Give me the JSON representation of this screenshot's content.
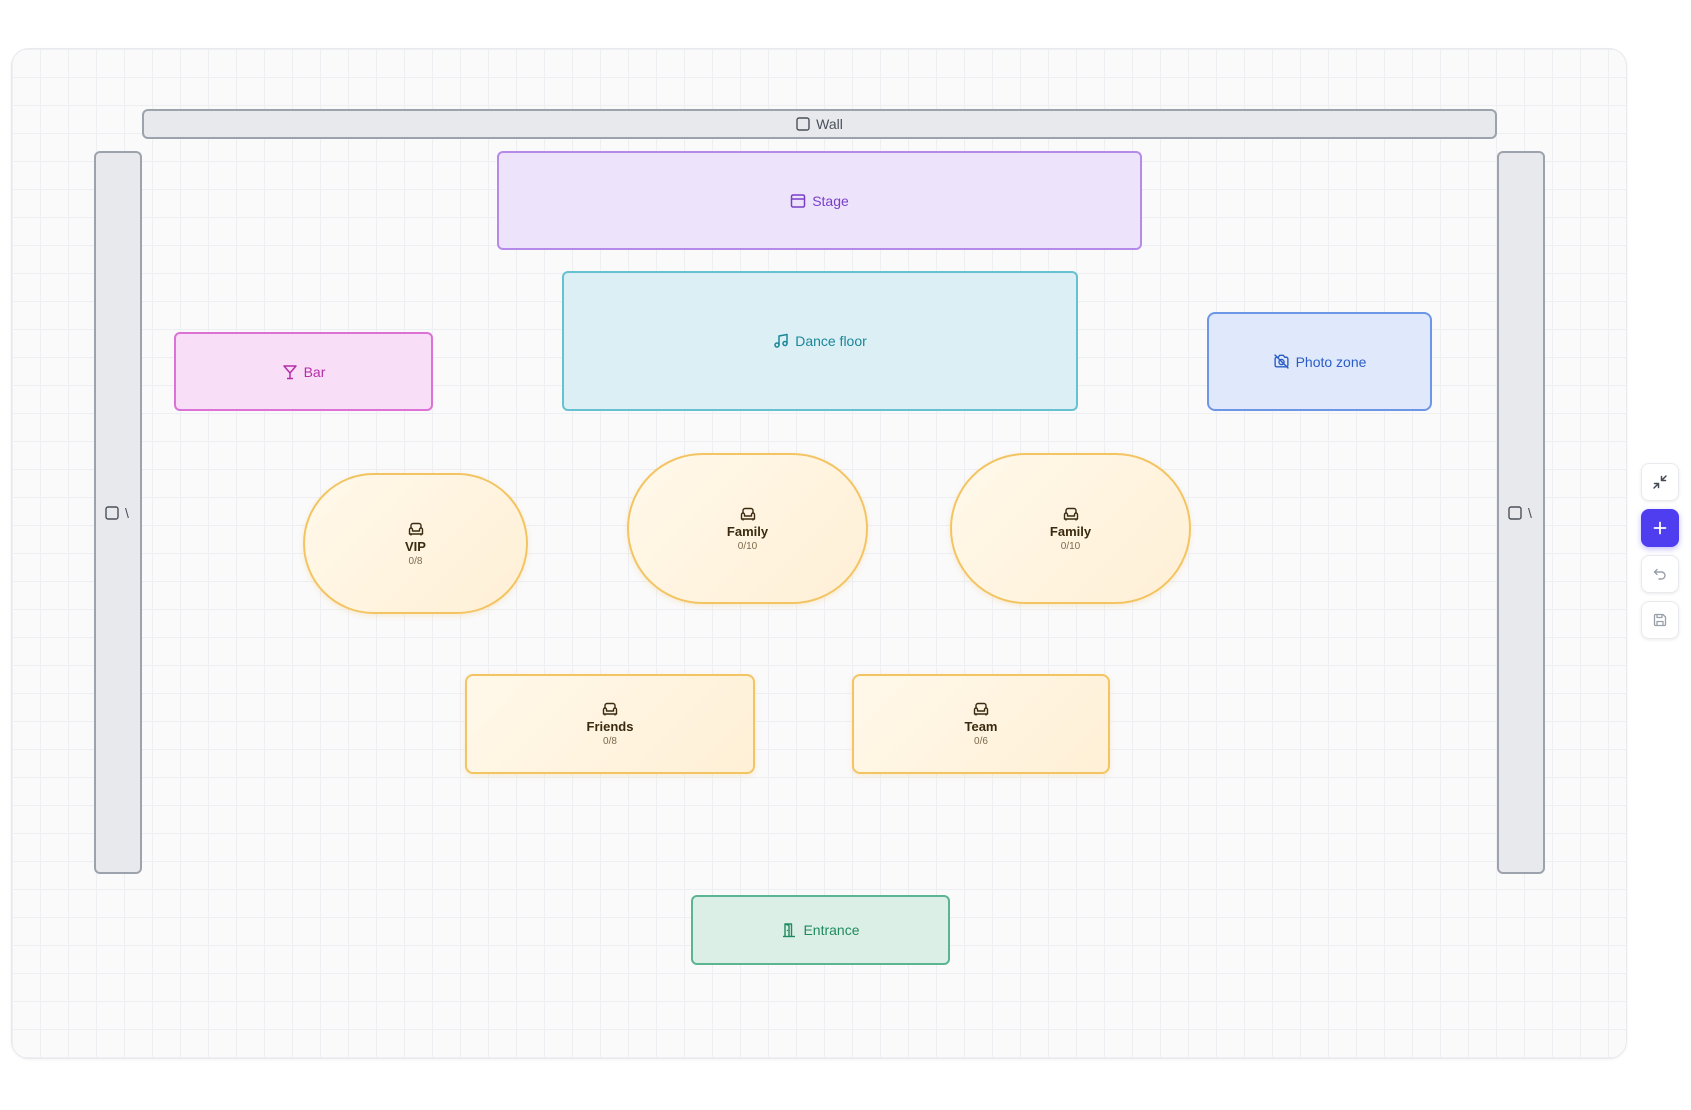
{
  "floor_plan": {
    "walls": {
      "top": {
        "label": "Wall"
      },
      "left": {
        "label": "\\"
      },
      "right": {
        "label": "\\"
      }
    },
    "zones": {
      "stage": {
        "label": "Stage",
        "icon": "stage-icon"
      },
      "dance_floor": {
        "label": "Dance floor",
        "icon": "music-note-icon"
      },
      "bar": {
        "label": "Bar",
        "icon": "cocktail-glass-icon"
      },
      "photo_zone": {
        "label": "Photo zone",
        "icon": "camera-off-icon"
      },
      "entrance": {
        "label": "Entrance",
        "icon": "door-open-icon"
      }
    },
    "tables": [
      {
        "name": "VIP",
        "capacity": "0/8",
        "shape": "round",
        "icon": "sofa-icon"
      },
      {
        "name": "Family",
        "capacity": "0/10",
        "shape": "round",
        "icon": "sofa-icon"
      },
      {
        "name": "Family",
        "capacity": "0/10",
        "shape": "round",
        "icon": "sofa-icon"
      },
      {
        "name": "Friends",
        "capacity": "0/8",
        "shape": "rect",
        "icon": "sofa-icon"
      },
      {
        "name": "Team",
        "capacity": "0/6",
        "shape": "rect",
        "icon": "sofa-icon"
      }
    ]
  },
  "toolbar": {
    "buttons": [
      {
        "name": "collapse",
        "icon": "minimize-icon"
      },
      {
        "name": "add",
        "icon": "plus-icon"
      },
      {
        "name": "undo",
        "icon": "undo-icon"
      },
      {
        "name": "save",
        "icon": "save-icon"
      }
    ]
  },
  "colors": {
    "accent": "#4f3df0",
    "table_border": "#f3c462",
    "stage": "#b58ae8",
    "dance_floor": "#66c2d0",
    "bar": "#dd72d6",
    "photo_zone": "#6d97e6",
    "entrance": "#5bb592",
    "wall": "#9da3ad"
  }
}
